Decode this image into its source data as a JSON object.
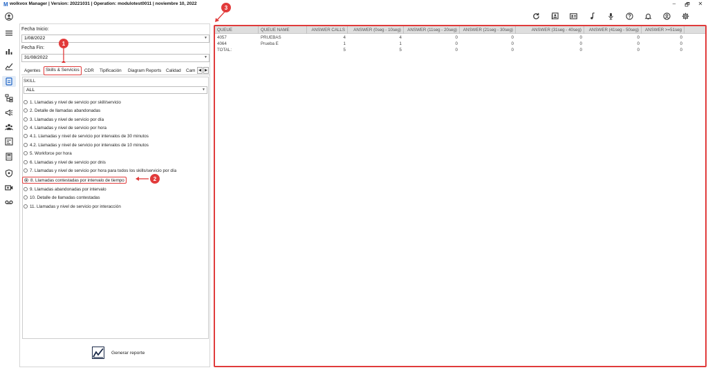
{
  "window": {
    "logo": "M",
    "title": "wolkvox Manager  | Version: 20221031 |  Operation: modulotest0011  | noviembre 10, 2022",
    "controls": [
      "–",
      "🗗",
      "✕"
    ]
  },
  "toolbar": {
    "icons": [
      "refresh-icon",
      "contacts-icon",
      "id-card-icon",
      "music-icon",
      "microphone-icon",
      "help-icon",
      "bell-icon",
      "user-circle-icon",
      "gear-icon"
    ]
  },
  "nav": {
    "icons": [
      "avatar-icon",
      "menu-icon",
      "bar-chart-icon",
      "analytics-icon",
      "reports-icon",
      "hierarchy-icon",
      "campaign-icon",
      "users-icon",
      "checklist-icon",
      "calculator-icon",
      "shield-icon",
      "video-icon",
      "voicemail-icon"
    ]
  },
  "filters": {
    "fecha_inicio_label": "Fecha Inicio:",
    "fecha_inicio_value": "1/08/2022",
    "fecha_fin_label": "Fecha Fin:",
    "fecha_fin_value": "31/08/2022"
  },
  "tabs": [
    "Agentes",
    "Skills & Servicios",
    "CDR",
    "Tipificación",
    "Diagram Reports",
    "Calidad",
    "Cam"
  ],
  "skill": {
    "label": "SKILL",
    "value": "ALL"
  },
  "reports": [
    "1. Llamadas y nivel de servicio por skill/servicio",
    "2. Detalle de llamadas abandonadas",
    "3. Llamadas y nivel de servicio por día",
    "4. Llamadas y nivel de servicio por hora",
    "4.1. Llamadas y nivel de servicio por intervalos de 30 minutos",
    "4.2. Llamadas y nivel de servicio por intervalos de 10 minutos",
    "5. Workforce por hora",
    "6. Llamadas y nivel de servicio por dnis",
    "7. Llamadas y nivel de servicio por hora para todos los skills/servicio por día",
    "8. Llamadas contestadas por intervalo de tiempo",
    "9. Llamadas abandonadas por intervalo",
    "10. Detalle de llamadas contestadas",
    "11. Llamadas y nivel de servicio por interacción"
  ],
  "selected_report_index": 9,
  "generate_button": "Generar reporte",
  "grid": {
    "headers": [
      "QUEUE",
      "QUEUE NAME",
      "ANSWER CALLS",
      "ANSWER (0seg - 10seg)",
      "ANSWER (11seg - 20seg)",
      "ANSWER (21seg - 30seg)",
      "ANSWER (31seg - 40seg)",
      "ANSWER (41seg - 50seg)",
      "ANSWER >=51seg"
    ],
    "rows": [
      [
        "4057",
        "PRUEBAS",
        "4",
        "4",
        "0",
        "0",
        "0",
        "0",
        "0"
      ],
      [
        "4064",
        "Prueba E",
        "1",
        "1",
        "0",
        "0",
        "0",
        "0",
        "0"
      ],
      [
        "TOTAL:",
        "",
        "5",
        "5",
        "0",
        "0",
        "0",
        "0",
        "0"
      ]
    ]
  },
  "callouts": [
    "1",
    "2",
    "3"
  ],
  "colors": {
    "accent_red": "#e03a3a",
    "brand_blue": "#1e63c6"
  }
}
